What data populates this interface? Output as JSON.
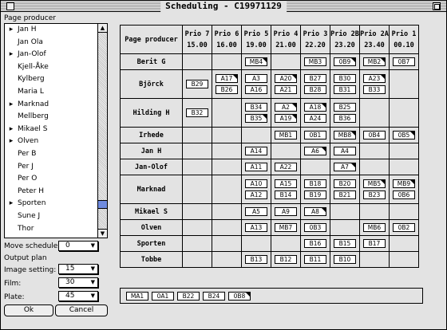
{
  "window": {
    "title": "Scheduling - C19971129"
  },
  "left": {
    "page_producer_label": "Page producer",
    "list": [
      {
        "name": "Jan H",
        "expand": true
      },
      {
        "name": "Jan Ola",
        "expand": false
      },
      {
        "name": "Jan-Olof",
        "expand": true
      },
      {
        "name": "Kjell-Åke",
        "expand": false
      },
      {
        "name": "Kylberg",
        "expand": false
      },
      {
        "name": "Maria L",
        "expand": false
      },
      {
        "name": "Marknad",
        "expand": true
      },
      {
        "name": "Mellberg",
        "expand": false
      },
      {
        "name": "Mikael S",
        "expand": true
      },
      {
        "name": "Olven",
        "expand": true
      },
      {
        "name": "Per B",
        "expand": false
      },
      {
        "name": "Per J",
        "expand": false
      },
      {
        "name": "Per O",
        "expand": false
      },
      {
        "name": "Peter H",
        "expand": false
      },
      {
        "name": "Sporten",
        "expand": true
      },
      {
        "name": "Sune J",
        "expand": false
      },
      {
        "name": "Thor",
        "expand": false
      }
    ],
    "move_schedule_label": "Move schedule",
    "move_schedule_value": "0",
    "output_plan_label": "Output plan",
    "image_setting_label": "Image setting:",
    "image_setting_value": "15",
    "film_label": "Film:",
    "film_value": "30",
    "plate_label": "Plate:",
    "plate_value": "45",
    "ok_label": "Ok",
    "cancel_label": "Cancel"
  },
  "grid": {
    "corner_label": "Page producer",
    "columns": [
      {
        "name": "Prio 7",
        "time": "15.00"
      },
      {
        "name": "Prio 6",
        "time": "16.00"
      },
      {
        "name": "Prio 5",
        "time": "19.00"
      },
      {
        "name": "Prio 4",
        "time": "21.00"
      },
      {
        "name": "Prio 3",
        "time": "22.20"
      },
      {
        "name": "Prio 2B",
        "time": "23.20"
      },
      {
        "name": "Prio 2A",
        "time": "23.40"
      },
      {
        "name": "Prio 1",
        "time": "00.10"
      }
    ],
    "rows": [
      {
        "name": "Berit G",
        "cells": [
          [],
          [],
          [
            {
              "t": "MB4",
              "f": true
            }
          ],
          [],
          [
            {
              "t": "MB3",
              "f": false
            }
          ],
          [
            {
              "t": "0B9",
              "f": true
            }
          ],
          [
            {
              "t": "MB2",
              "f": true
            }
          ],
          [
            {
              "t": "0B7",
              "f": false
            }
          ]
        ]
      },
      {
        "name": "Björck",
        "cells": [
          [
            {
              "t": "B29",
              "f": false
            }
          ],
          [
            {
              "t": "A17",
              "f": true
            },
            {
              "t": "B26",
              "f": false
            }
          ],
          [
            {
              "t": "A3",
              "f": false
            },
            {
              "t": "A16",
              "f": false
            }
          ],
          [
            {
              "t": "A20",
              "f": true
            },
            {
              "t": "A21",
              "f": false
            }
          ],
          [
            {
              "t": "B27",
              "f": false
            },
            {
              "t": "B28",
              "f": false
            }
          ],
          [
            {
              "t": "B30",
              "f": false
            },
            {
              "t": "B31",
              "f": false
            }
          ],
          [
            {
              "t": "A23",
              "f": true
            },
            {
              "t": "B33",
              "f": false
            }
          ],
          []
        ]
      },
      {
        "name": "Hilding H",
        "cells": [
          [
            {
              "t": "B32",
              "f": false
            }
          ],
          [],
          [
            {
              "t": "B34",
              "f": false
            },
            {
              "t": "B35",
              "f": true
            }
          ],
          [
            {
              "t": "A2",
              "f": true
            },
            {
              "t": "A19",
              "f": true
            }
          ],
          [
            {
              "t": "A18",
              "f": true
            },
            {
              "t": "A24",
              "f": false
            }
          ],
          [
            {
              "t": "B25",
              "f": false
            },
            {
              "t": "B36",
              "f": false
            }
          ],
          [],
          []
        ]
      },
      {
        "name": "Irhede",
        "cells": [
          [],
          [],
          [],
          [
            {
              "t": "MB1",
              "f": false
            }
          ],
          [
            {
              "t": "0B1",
              "f": false
            }
          ],
          [
            {
              "t": "MB8",
              "f": true
            }
          ],
          [
            {
              "t": "0B4",
              "f": false
            }
          ],
          [
            {
              "t": "0B5",
              "f": true
            }
          ]
        ]
      },
      {
        "name": "Jan H",
        "cells": [
          [],
          [],
          [
            {
              "t": "A14",
              "f": false
            }
          ],
          [],
          [
            {
              "t": "A6",
              "f": true
            }
          ],
          [
            {
              "t": "A4",
              "f": false
            }
          ],
          [],
          []
        ]
      },
      {
        "name": "Jan-Olof",
        "cells": [
          [],
          [],
          [
            {
              "t": "A11",
              "f": false
            }
          ],
          [
            {
              "t": "A22",
              "f": false
            }
          ],
          [],
          [
            {
              "t": "A7",
              "f": true
            }
          ],
          [],
          []
        ]
      },
      {
        "name": "Marknad",
        "cells": [
          [],
          [],
          [
            {
              "t": "A10",
              "f": false
            },
            {
              "t": "A12",
              "f": false
            }
          ],
          [
            {
              "t": "A15",
              "f": false
            },
            {
              "t": "B14",
              "f": false
            }
          ],
          [
            {
              "t": "B18",
              "f": false
            },
            {
              "t": "B19",
              "f": false
            }
          ],
          [
            {
              "t": "B20",
              "f": false
            },
            {
              "t": "B21",
              "f": false
            }
          ],
          [
            {
              "t": "MB5",
              "f": true
            },
            {
              "t": "B23",
              "f": false
            }
          ],
          [
            {
              "t": "MB9",
              "f": true
            },
            {
              "t": "0B6",
              "f": false
            }
          ]
        ]
      },
      {
        "name": "Mikael S",
        "cells": [
          [],
          [],
          [
            {
              "t": "A5",
              "f": false
            }
          ],
          [
            {
              "t": "A9",
              "f": false
            }
          ],
          [
            {
              "t": "A8",
              "f": true
            }
          ],
          [],
          [],
          []
        ]
      },
      {
        "name": "Olven",
        "cells": [
          [],
          [],
          [
            {
              "t": "A13",
              "f": false
            }
          ],
          [
            {
              "t": "MB7",
              "f": false
            }
          ],
          [
            {
              "t": "0B3",
              "f": false
            }
          ],
          [],
          [
            {
              "t": "MB6",
              "f": false
            }
          ],
          [
            {
              "t": "0B2",
              "f": false
            }
          ]
        ]
      },
      {
        "name": "Sporten",
        "cells": [
          [],
          [],
          [],
          [],
          [
            {
              "t": "B16",
              "f": false
            }
          ],
          [
            {
              "t": "B15",
              "f": false
            }
          ],
          [
            {
              "t": "B17",
              "f": false
            }
          ],
          []
        ]
      },
      {
        "name": "Tobbe",
        "cells": [
          [],
          [],
          [
            {
              "t": "B13",
              "f": false
            }
          ],
          [
            {
              "t": "B12",
              "f": false
            }
          ],
          [
            {
              "t": "B11",
              "f": false
            }
          ],
          [
            {
              "t": "B10",
              "f": false
            }
          ],
          [],
          []
        ]
      }
    ]
  },
  "unassigned": [
    {
      "t": "MA1",
      "f": false
    },
    {
      "t": "0A1",
      "f": false
    },
    {
      "t": "B22",
      "f": false
    },
    {
      "t": "B24",
      "f": false
    },
    {
      "t": "0B8",
      "f": true
    }
  ]
}
